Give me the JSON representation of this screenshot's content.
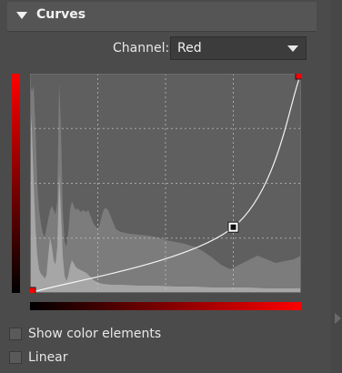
{
  "panel": {
    "title": "Curves",
    "channel_label": "Channel:",
    "channel_value": "Red",
    "accent_color": "#ff0000",
    "show_color_elements_label": "Show color elements",
    "show_color_elements_checked": false,
    "linear_label": "Linear",
    "linear_checked": false
  },
  "curve": {
    "points": [
      {
        "x": 0.0,
        "y": 0.0
      },
      {
        "x": 0.75,
        "y": 0.3
      },
      {
        "x": 1.0,
        "y": 1.0
      }
    ]
  },
  "icons": {
    "collapse": "triangle-down-icon",
    "dropdown": "chevron-down-icon",
    "panel_expand": "triangle-right-icon"
  }
}
